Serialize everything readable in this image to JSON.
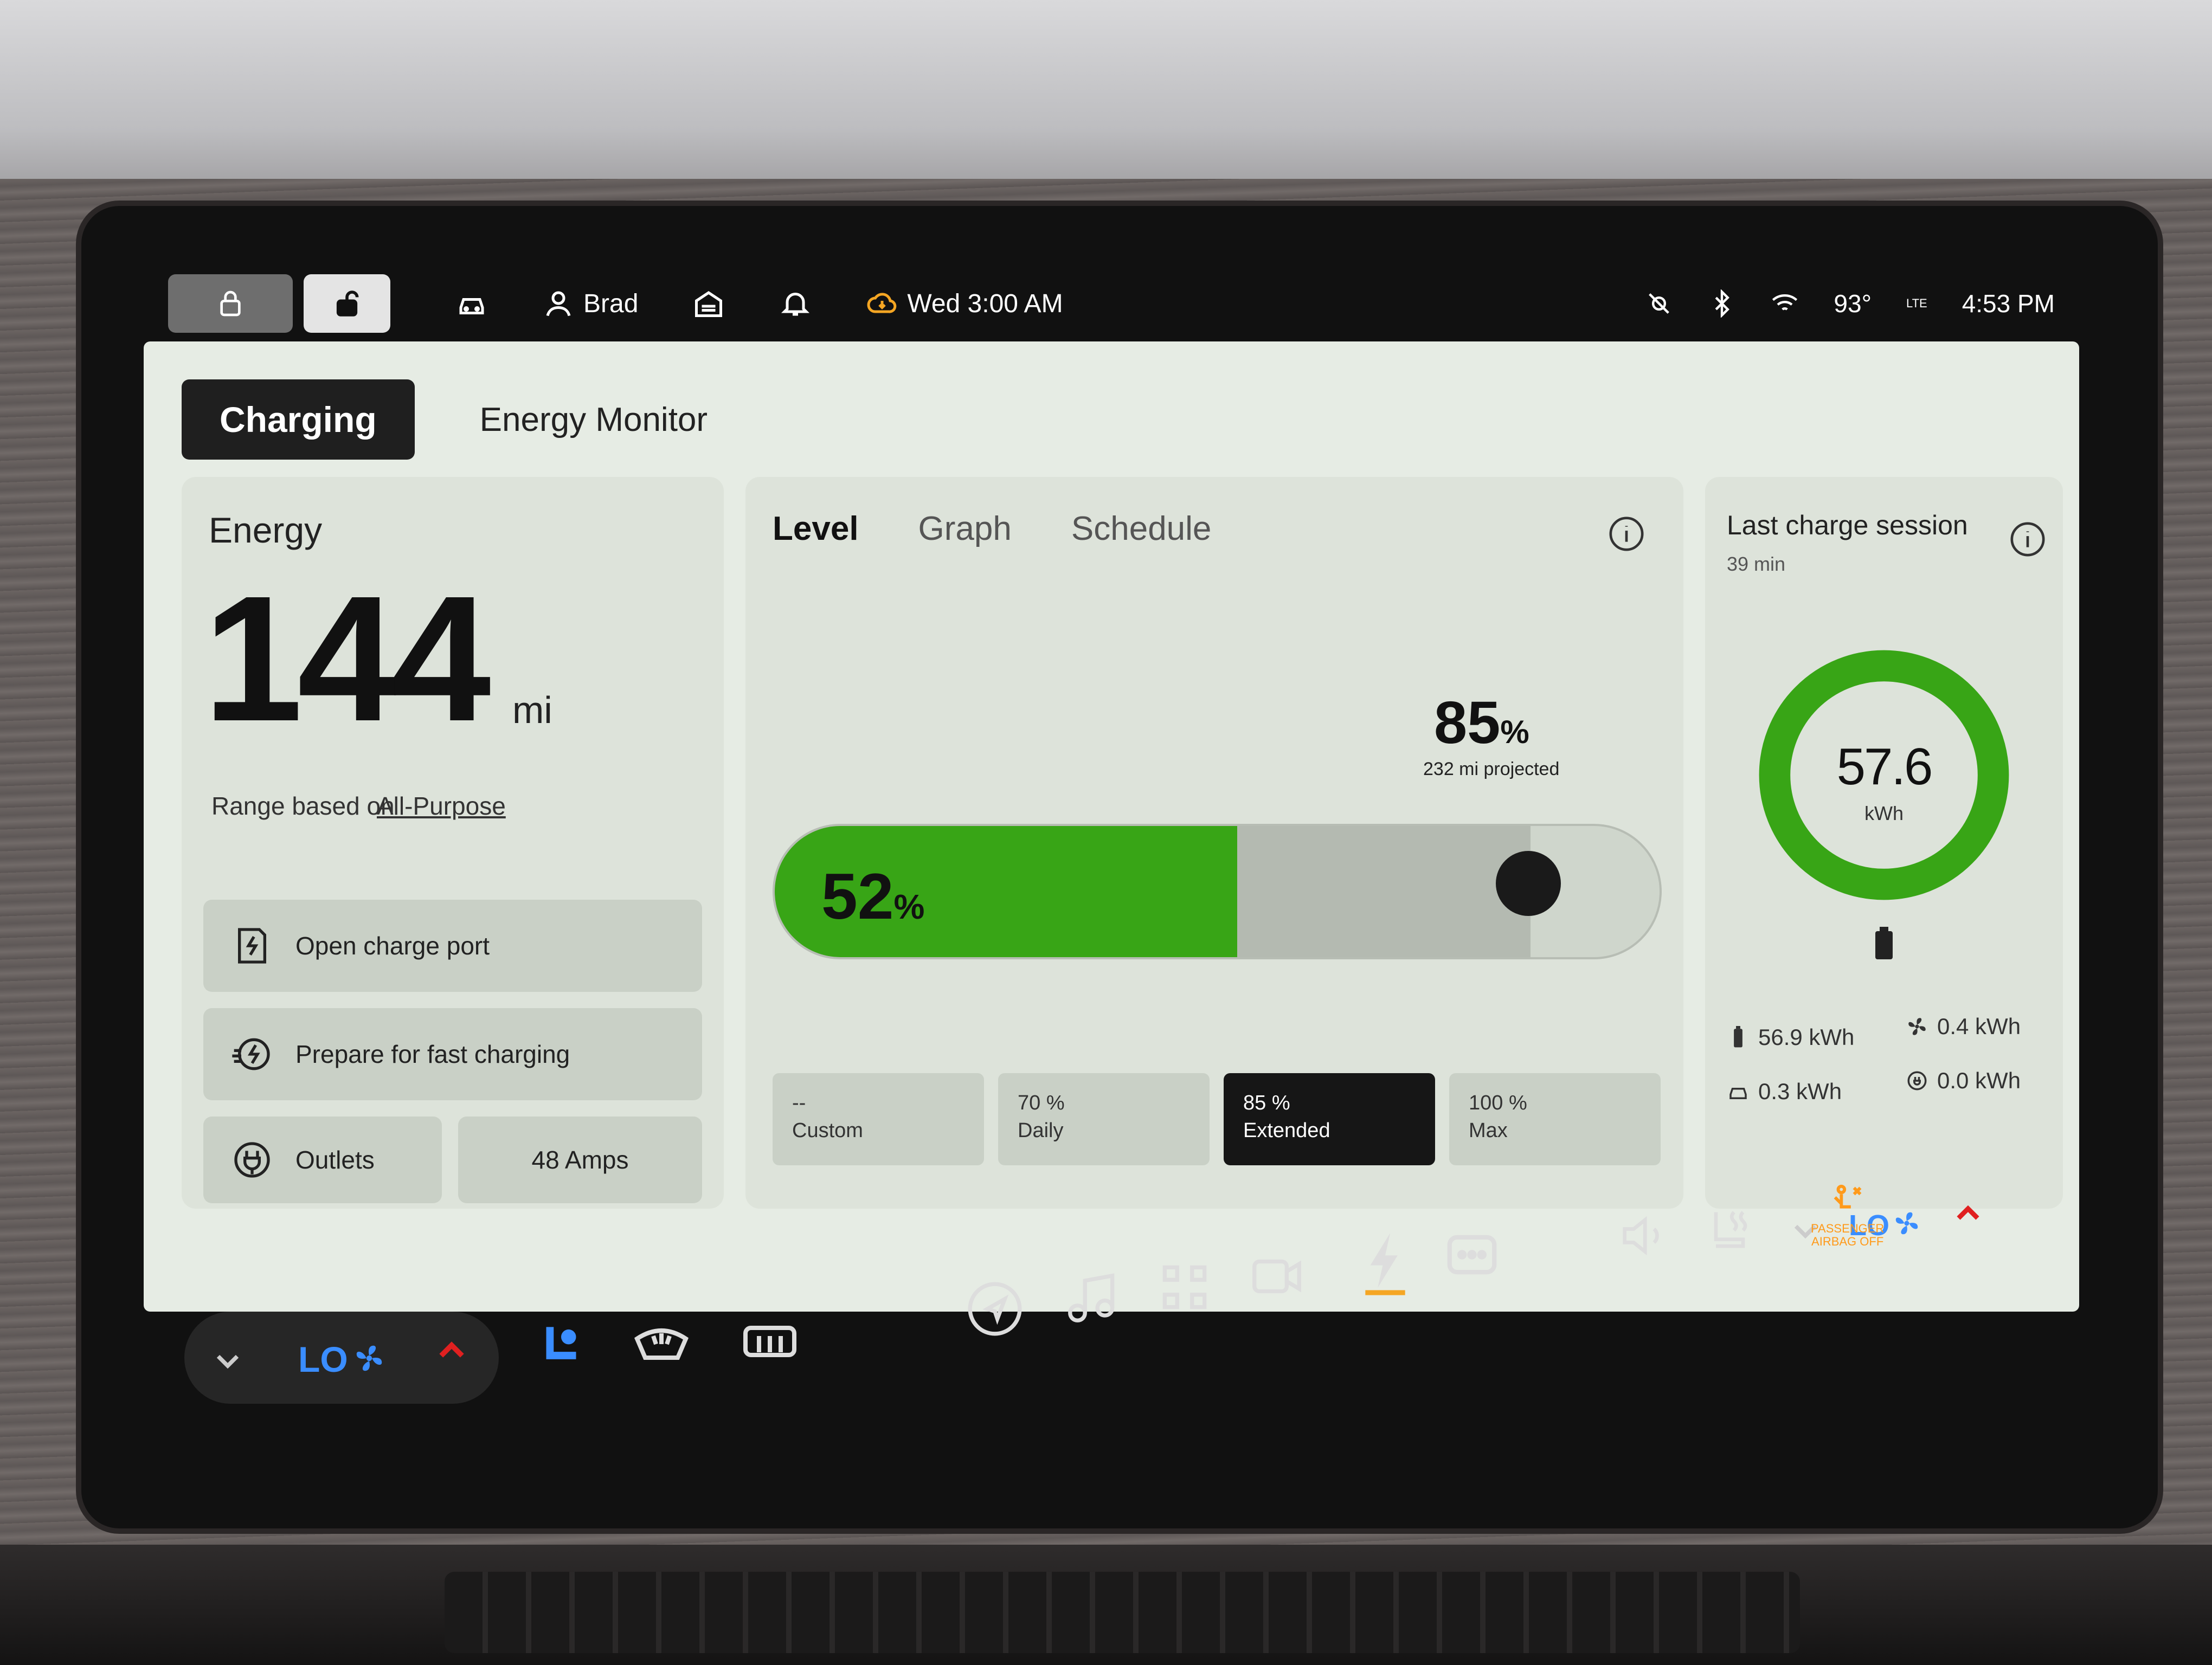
{
  "top_bar": {
    "profile_name": "Brad",
    "scheduled_update": "Wed 3:00 AM",
    "temperature": "93°",
    "network": "LTE",
    "clock": "4:53 PM"
  },
  "tabs": {
    "active": "Charging",
    "other": "Energy Monitor"
  },
  "energy": {
    "title": "Energy",
    "range_value": "144",
    "range_unit": "mi",
    "range_basis_label": "Range based on",
    "range_mode": "All-Purpose",
    "open_port_label": "Open charge port",
    "fast_charge_label": "Prepare for fast charging",
    "outlets_label": "Outlets",
    "amps_label": "48 Amps"
  },
  "level": {
    "tabs": [
      "Level",
      "Graph",
      "Schedule"
    ],
    "current_percent": 52,
    "current_label": "52",
    "target_percent": 85,
    "target_label": "85",
    "percent_sign": "%",
    "projected": "232 mi projected",
    "presets": [
      {
        "value": "--",
        "name": "Custom"
      },
      {
        "value": "70 %",
        "name": "Daily"
      },
      {
        "value": "85 %",
        "name": "Extended"
      },
      {
        "value": "100 %",
        "name": "Max"
      }
    ],
    "selected_preset": "Extended"
  },
  "session": {
    "title": "Last charge session",
    "duration": "39 min",
    "total_kwh": "57.6",
    "unit": "kWh",
    "battery_kwh": "56.9 kWh",
    "climate_kwh": "0.4 kWh",
    "vehicle_kwh": "0.3 kWh",
    "outlet_kwh": "0.0 kWh"
  },
  "climate": {
    "fan_level_left": "LO",
    "fan_level_right": "LO"
  },
  "airbag": {
    "line1": "PASSENGER",
    "line2": "AIRBAG OFF"
  },
  "colors": {
    "charge_green": "#38a516",
    "fan_blue": "#3a8dff",
    "charge_accent": "#f5a623"
  }
}
